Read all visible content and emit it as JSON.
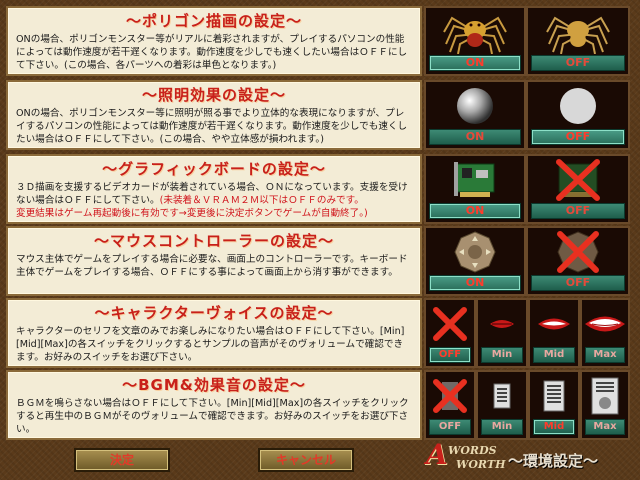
{
  "sections": [
    {
      "title": "～ポリゴン描画の設定～",
      "desc": "ONの場合、ポリゴンモンスター等がリアルに着彩されますが、プレイするパソコンの性能によっては動作速度が若干遅くなります。動作速度を少しでも速くしたい場合はＯＦＦにして下さい。(この場合、各パーツへの着彩は単色となります。)",
      "buttons": [
        {
          "label": "ON",
          "icon": "spider-full-color-icon"
        },
        {
          "label": "OFF",
          "icon": "spider-single-color-icon"
        }
      ]
    },
    {
      "title": "～照明効果の設定～",
      "desc": "ONの場合、ポリゴンモンスター等に照明が照る事でより立体的な表現になりますが、プレイするパソコンの性能によっては動作速度が若干遅くなります。動作速度を少しでも速くしたい場合はＯＦＦにして下さい。(この場合、やや立体感が損われます。)",
      "buttons": [
        {
          "label": "ON",
          "icon": "shaded-sphere-icon"
        },
        {
          "label": "OFF",
          "icon": "flat-sphere-icon"
        }
      ]
    },
    {
      "title": "～グラフィックボードの設定～",
      "desc": "３Ｄ描画を支援するビデオカードが装着されている場合、ＯＮになっています。支援を受けない場合はＯＦＦにして下さい。",
      "warn1": "(未装着＆ＶＲＡＭ２Ｍ以下はＯＦＦのみです。",
      "warn2": "変更結果はゲーム再起動後に有効です→変更後に決定ボタンでゲームが自動終了。)",
      "buttons": [
        {
          "label": "ON",
          "icon": "graphics-card-icon"
        },
        {
          "label": "OFF",
          "icon": "graphics-card-crossed-icon"
        }
      ]
    },
    {
      "title": "～マウスコントローラーの設定～",
      "desc": "マウス主体でゲームをプレイする場合に必要な、画面上のコントローラーです。キーボード主体でゲームをプレイする場合、ＯＦＦにする事によって画面上から消す事ができます。",
      "buttons": [
        {
          "label": "ON",
          "icon": "mouse-controller-icon"
        },
        {
          "label": "OFF",
          "icon": "mouse-controller-crossed-icon"
        }
      ]
    },
    {
      "title": "～キャラクターヴォイスの設定～",
      "desc": "キャラクターのセリフを文章のみでお楽しみになりたい場合はＯＦＦにして下さい。[Min][Mid][Max]の各スイッチをクリックするとサンプルの音声がそのヴォリュームで確認できます。お好みのスイッチをお選び下さい。",
      "buttons": [
        {
          "label": "OFF",
          "icon": "red-x-icon"
        },
        {
          "label": "Min",
          "icon": "lips-small-icon"
        },
        {
          "label": "Mid",
          "icon": "lips-medium-icon"
        },
        {
          "label": "Max",
          "icon": "lips-large-icon"
        }
      ]
    },
    {
      "title": "～BGM&効果音の設定～",
      "desc": "ＢＧＭを鳴らさない場合はＯＦＦにして下さい。[Min][Mid][Max]の各スイッチをクリックすると再生中のＢＧＭがそのヴォリュームで確認できます。お好みのスイッチをお選び下さい。",
      "buttons": [
        {
          "label": "OFF",
          "icon": "speaker-crossed-icon"
        },
        {
          "label": "Min",
          "icon": "speaker-small-icon"
        },
        {
          "label": "Mid",
          "icon": "speaker-medium-icon"
        },
        {
          "label": "Max",
          "icon": "speaker-large-icon"
        }
      ]
    }
  ],
  "footer": {
    "ok_label": "決定",
    "cancel_label": "キャンセル",
    "logo_a": "A",
    "logo_words": "WORDS",
    "logo_worth": "WORTH",
    "screen_title": "～環境設定～"
  },
  "colors": {
    "title_red": "#c8201a",
    "button_teal": "#2a6e5a",
    "panel_bg": "#f3ecd6"
  }
}
